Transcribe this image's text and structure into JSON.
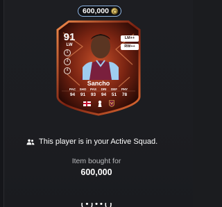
{
  "price_pill": {
    "amount": "600,000",
    "icon": "coin-icon"
  },
  "card": {
    "rating": "91",
    "position": "LW",
    "badges": [
      "5",
      "4",
      "4"
    ],
    "roles": [
      "LM++",
      "RW++"
    ],
    "name": "Sancho",
    "stat_labels": [
      "PAC",
      "SHO",
      "PAS",
      "DRI",
      "DEF",
      "PHY"
    ],
    "stat_values": [
      "94",
      "91",
      "93",
      "94",
      "51",
      "78"
    ],
    "nation_icon": "england-flag-icon",
    "league_icon": "premier-league-icon",
    "club_icon": "aston-villa-icon",
    "colors": {
      "frame": "#6b1f10",
      "glow": "#e26a2c",
      "shirt": "#7a1f3d"
    }
  },
  "squad_message": {
    "icon": "people-icon",
    "text": "This player is in your Active Squad."
  },
  "bought": {
    "label": "Item bought for",
    "value": "600,000"
  },
  "cut_off_text": "( • ) • • ( )"
}
